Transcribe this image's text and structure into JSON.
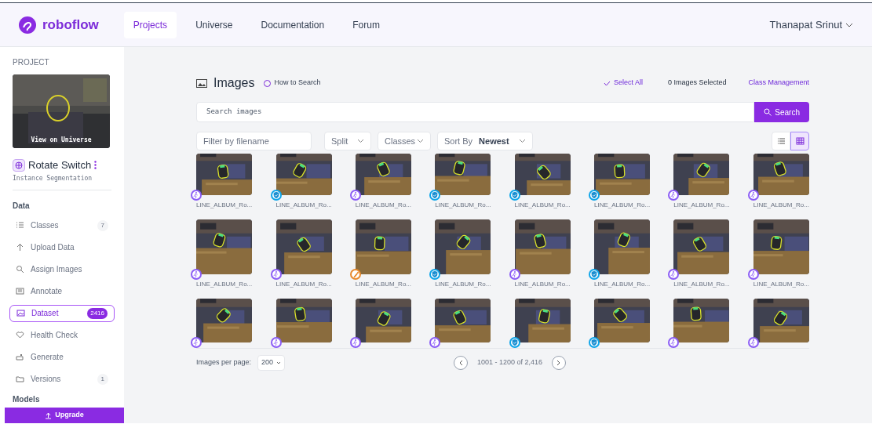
{
  "nav": {
    "logo": "roboflow",
    "links": [
      {
        "label": "Projects",
        "selected": true
      },
      {
        "label": "Universe",
        "selected": false
      },
      {
        "label": "Documentation",
        "selected": false
      },
      {
        "label": "Forum",
        "selected": false
      }
    ],
    "user": "Thanapat Srinut"
  },
  "sidebar": {
    "heading": "PROJECT",
    "preview": {
      "caption": "View on Universe"
    },
    "project_name": "Rotate Switch",
    "project_type": "Instance Segmentation",
    "sections": [
      {
        "title": "Data",
        "items": [
          {
            "label": "Classes",
            "count": "7",
            "selected": false
          },
          {
            "label": "Upload Data",
            "selected": false
          },
          {
            "label": "Assign Images",
            "selected": false
          },
          {
            "label": "Annotate",
            "selected": false
          },
          {
            "label": "Dataset",
            "count": "2416",
            "selected": true
          },
          {
            "label": "Health Check",
            "selected": false
          },
          {
            "label": "Generate",
            "selected": false
          },
          {
            "label": "Versions",
            "count": "1",
            "selected": false
          }
        ]
      },
      {
        "title": "Models"
      }
    ],
    "upgrade": "Upgrade"
  },
  "main": {
    "title": "Images",
    "help": "How to Search",
    "select_all": "Select All",
    "selected_count": "0 Images Selected",
    "class_management": "Class Management",
    "search": {
      "placeholder": "Search images",
      "button": "Search"
    },
    "filters": {
      "filename_placeholder": "Filter by filename",
      "split": "Split",
      "classes": "Classes",
      "sort_label": "Sort By",
      "sort_value": "Newest"
    },
    "view": [
      {
        "kind": "list",
        "selected": false
      },
      {
        "kind": "grid",
        "selected": true
      }
    ],
    "rows": [
      {
        "images": [
          {
            "kind": "train",
            "caption": "LINE_ALBUM_Ro..."
          },
          {
            "kind": "valid",
            "caption": "LINE_ALBUM_Ro..."
          },
          {
            "kind": "train",
            "caption": "LINE_ALBUM_Ro..."
          },
          {
            "kind": "valid",
            "caption": "LINE_ALBUM_Ro..."
          },
          {
            "kind": "valid",
            "caption": "LINE_ALBUM_Ro..."
          },
          {
            "kind": "valid",
            "caption": "LINE_ALBUM_Ro..."
          },
          {
            "kind": "train",
            "caption": "LINE_ALBUM_Ro..."
          },
          {
            "kind": "train",
            "caption": "LINE_ALBUM_Ro..."
          }
        ]
      },
      {
        "images": [
          {
            "kind": "train",
            "caption": "LINE_ALBUM_Ro..."
          },
          {
            "kind": "train",
            "caption": "LINE_ALBUM_Ro..."
          },
          {
            "kind": "test",
            "caption": "LINE_ALBUM_Ro..."
          },
          {
            "kind": "valid",
            "caption": "LINE_ALBUM_Ro..."
          },
          {
            "kind": "train",
            "caption": "LINE_ALBUM_Ro..."
          },
          {
            "kind": "valid",
            "caption": "LINE_ALBUM_Ro..."
          },
          {
            "kind": "train",
            "caption": "LINE_ALBUM_Ro..."
          },
          {
            "kind": "train",
            "caption": "LINE_ALBUM_Ro..."
          }
        ]
      },
      {
        "images": [
          {
            "kind": "train"
          },
          {
            "kind": "train"
          },
          {
            "kind": "train"
          },
          {
            "kind": "train"
          },
          {
            "kind": "valid"
          },
          {
            "kind": "valid"
          },
          {
            "kind": "train"
          },
          {
            "kind": "train"
          }
        ]
      }
    ],
    "pagination": {
      "per_page_label": "Images per page:",
      "per_page": "200",
      "range": "1001 - 1200 of 2,416"
    }
  }
}
